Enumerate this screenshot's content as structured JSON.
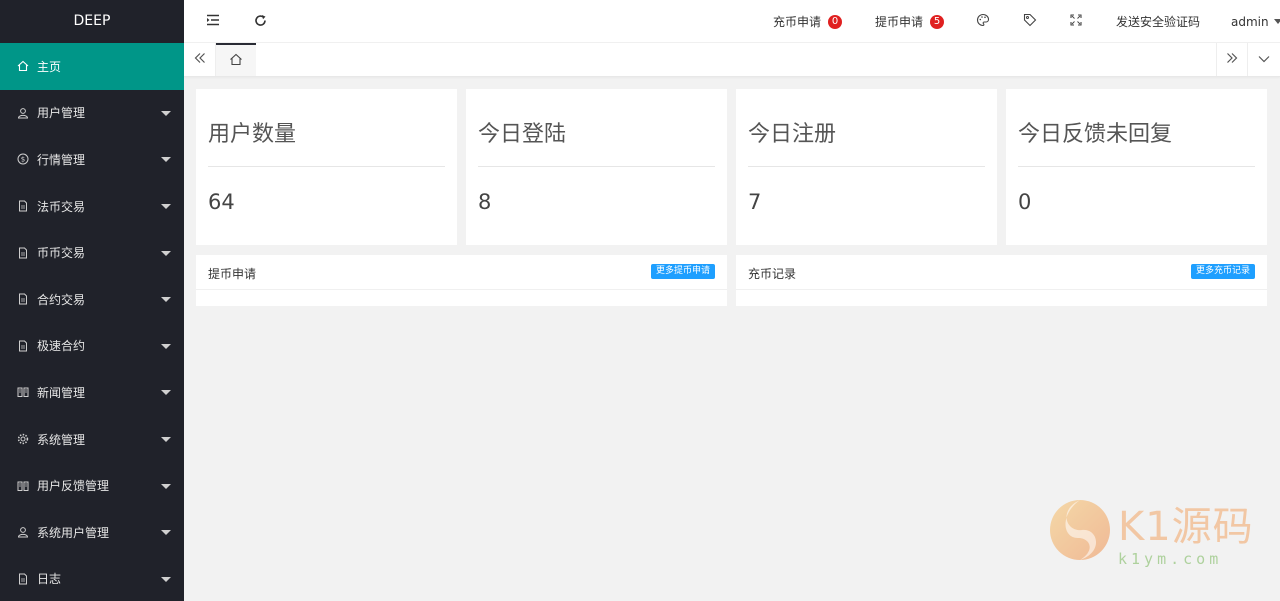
{
  "sidebar": {
    "logo": "DEEP",
    "items": [
      {
        "label": "主页",
        "icon": "home-icon",
        "active": true
      },
      {
        "label": "用户管理",
        "icon": "user-icon"
      },
      {
        "label": "行情管理",
        "icon": "dollar-icon"
      },
      {
        "label": "法币交易",
        "icon": "document-icon"
      },
      {
        "label": "币币交易",
        "icon": "document-icon"
      },
      {
        "label": "合约交易",
        "icon": "document-icon"
      },
      {
        "label": "极速合约",
        "icon": "document-icon"
      },
      {
        "label": "新闻管理",
        "icon": "book-icon"
      },
      {
        "label": "系统管理",
        "icon": "gear-icon"
      },
      {
        "label": "用户反馈管理",
        "icon": "book-icon"
      },
      {
        "label": "系统用户管理",
        "icon": "user-icon"
      },
      {
        "label": "日志",
        "icon": "document-icon"
      }
    ]
  },
  "header": {
    "recharge_label": "充币申请",
    "recharge_count": "0",
    "withdraw_label": "提币申请",
    "withdraw_count": "5",
    "send_code_label": "发送安全验证码",
    "user": "admin"
  },
  "stats": [
    {
      "title": "用户数量",
      "value": "64"
    },
    {
      "title": "今日登陆",
      "value": "8"
    },
    {
      "title": "今日注册",
      "value": "7"
    },
    {
      "title": "今日反馈未回复",
      "value": "0"
    }
  ],
  "panels": {
    "withdraw": {
      "title": "提币申请",
      "button": "更多提币申请"
    },
    "recharge": {
      "title": "充币记录",
      "button": "更多充币记录"
    }
  },
  "watermark": {
    "brand": "K1源码",
    "domain": "k1ym.com"
  },
  "colors": {
    "sidebar_bg": "#20222a",
    "active_green": "#009688",
    "badge_red": "#e02020",
    "button_blue": "#1e9fff"
  }
}
